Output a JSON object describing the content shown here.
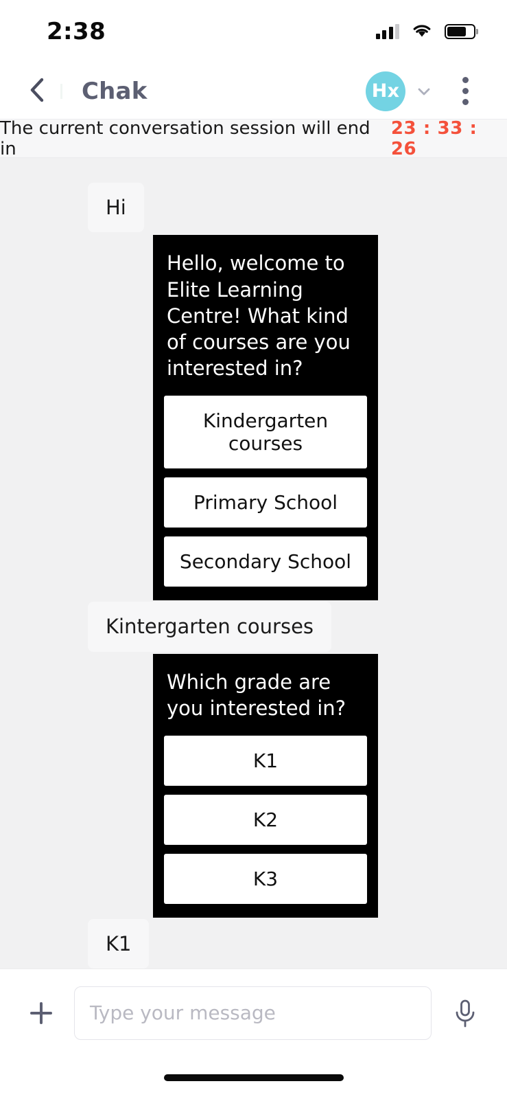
{
  "status_bar": {
    "time": "2:38",
    "signal_icon": "cellular-signal-icon",
    "wifi_icon": "wifi-icon",
    "battery_icon": "battery-icon"
  },
  "nav_bar": {
    "back_icon": "chevron-left-icon",
    "title": "Chak",
    "avatar_initials": "Hx",
    "avatar_color": "#73d3e3",
    "chevron_icon": "chevron-down-icon",
    "menu_icon": "kebab-menu-icon"
  },
  "session_banner": {
    "text": "The current conversation session will end in",
    "timer": "23 : 33 : 26",
    "timer_color": "#f4513b"
  },
  "messages": [
    {
      "sender": "user",
      "text": "Hi"
    },
    {
      "sender": "bot",
      "text": "Hello, welcome to Elite Learning Centre! What kind of courses are you interested in?",
      "options": [
        "Kindergarten courses",
        "Primary School",
        "Secondary School"
      ]
    },
    {
      "sender": "user",
      "text": "Kintergarten courses"
    },
    {
      "sender": "bot",
      "text": "Which grade are you interested in?",
      "options": [
        "K1",
        "K2",
        "K3"
      ]
    },
    {
      "sender": "user",
      "text": "K1"
    }
  ],
  "input_bar": {
    "attach_icon": "plus-icon",
    "placeholder": "Type your message",
    "value": "",
    "mic_icon": "microphone-icon"
  },
  "home_indicator": "home-indicator"
}
